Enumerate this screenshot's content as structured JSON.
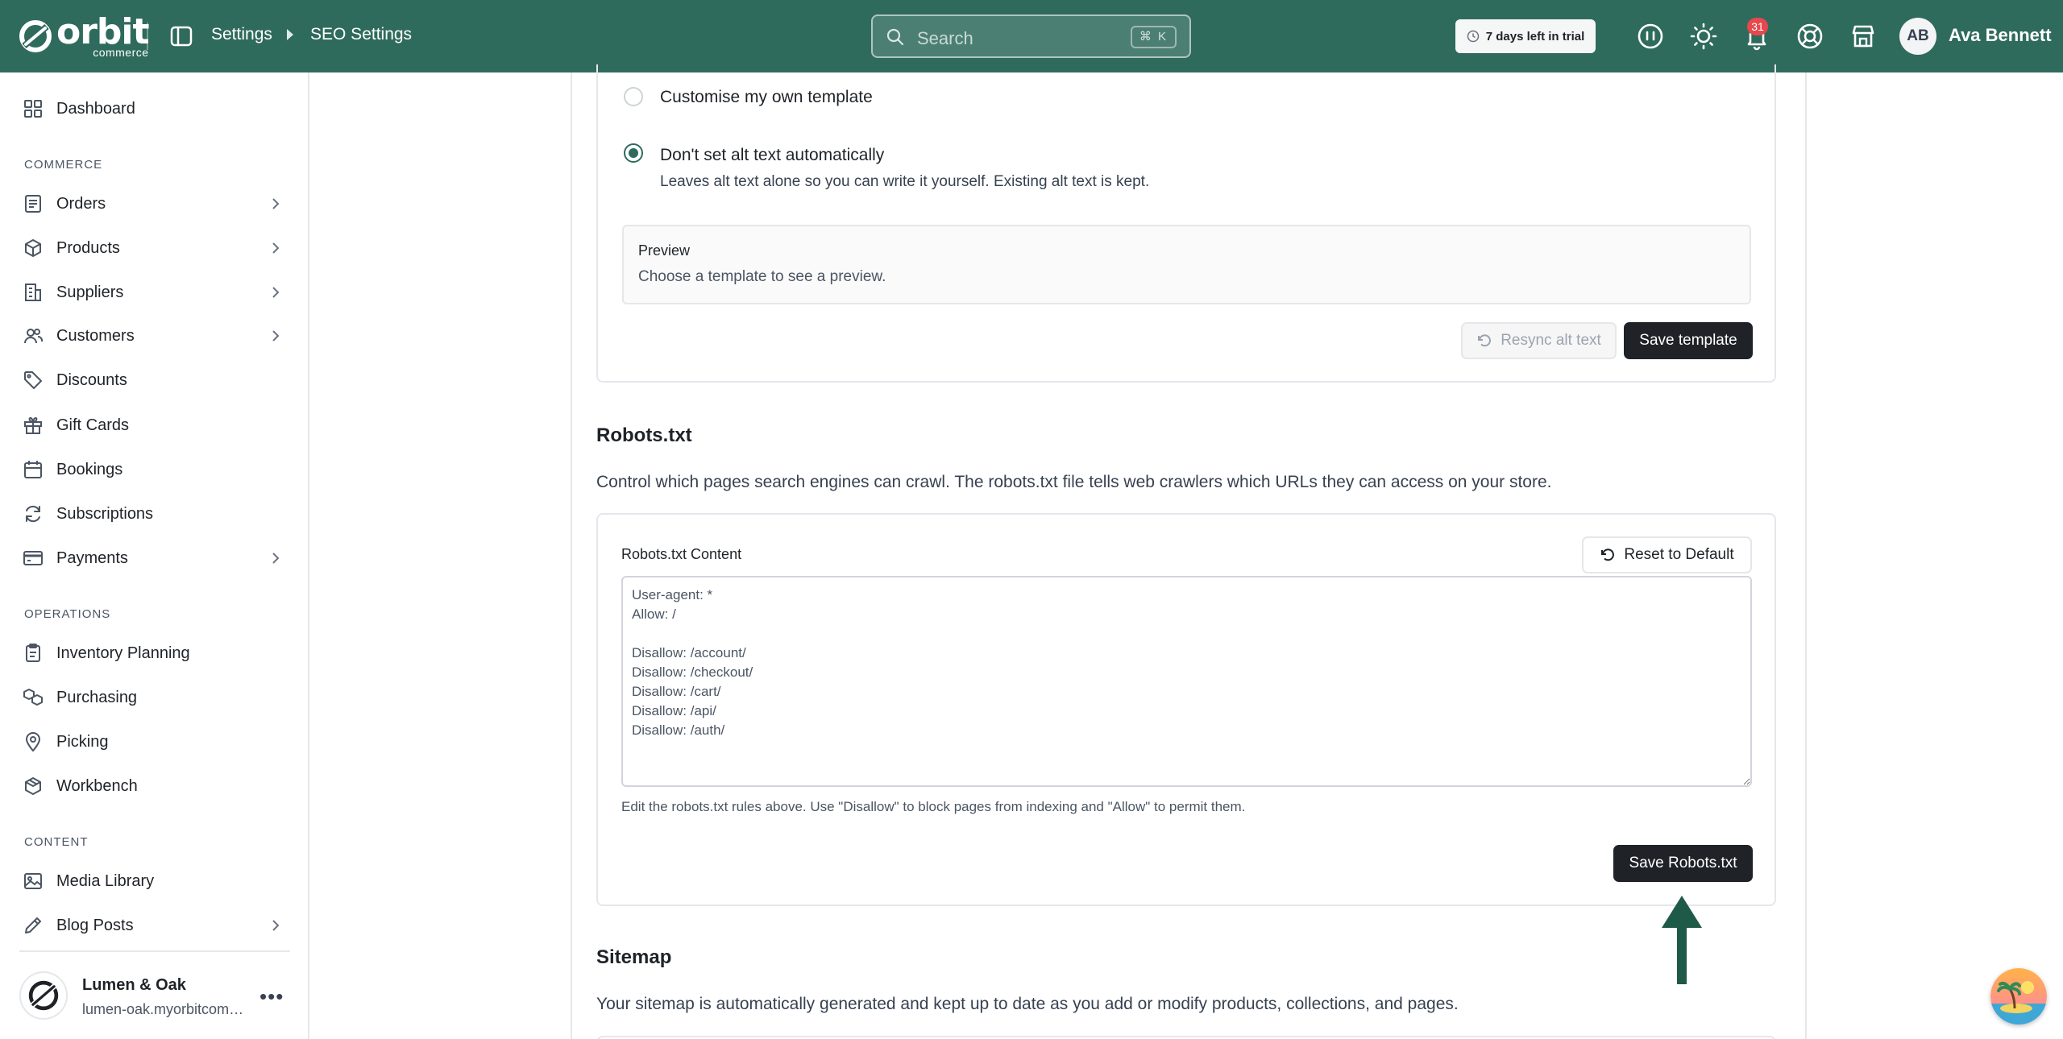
{
  "topbar": {
    "logo_word": "orbit",
    "logo_sub": "commerce",
    "breadcrumb": [
      "Settings",
      "SEO Settings"
    ],
    "search_placeholder": "Search",
    "search_shortcut": "⌘ K",
    "trial_text": "7 days left in trial",
    "notification_count": "31",
    "avatar_initials": "AB",
    "user_name": "Ava Bennett"
  },
  "sidebar": {
    "dashboard": "Dashboard",
    "sections": {
      "commerce": "COMMERCE",
      "operations": "OPERATIONS",
      "content": "CONTENT"
    },
    "commerce_items": [
      {
        "label": "Orders",
        "icon": "orders-icon",
        "has_children": true
      },
      {
        "label": "Products",
        "icon": "box-icon",
        "has_children": true
      },
      {
        "label": "Suppliers",
        "icon": "building-icon",
        "has_children": true
      },
      {
        "label": "Customers",
        "icon": "users-icon",
        "has_children": true
      },
      {
        "label": "Discounts",
        "icon": "tag-icon",
        "has_children": false
      },
      {
        "label": "Gift Cards",
        "icon": "gift-icon",
        "has_children": false
      },
      {
        "label": "Bookings",
        "icon": "calendar-icon",
        "has_children": false
      },
      {
        "label": "Subscriptions",
        "icon": "refresh-icon",
        "has_children": false
      },
      {
        "label": "Payments",
        "icon": "credit-card-icon",
        "has_children": true
      }
    ],
    "operations_items": [
      {
        "label": "Inventory Planning",
        "icon": "clipboard-icon"
      },
      {
        "label": "Purchasing",
        "icon": "boxes-icon"
      },
      {
        "label": "Picking",
        "icon": "map-pin-icon"
      },
      {
        "label": "Workbench",
        "icon": "package-icon"
      }
    ],
    "content_items": [
      {
        "label": "Media Library",
        "icon": "image-icon",
        "has_children": false
      },
      {
        "label": "Blog Posts",
        "icon": "pencil-icon",
        "has_children": true
      }
    ],
    "store": {
      "name": "Lumen & Oak",
      "url": "lumen-oak.myorbitcommerce.com"
    }
  },
  "alt_text": {
    "option_custom": "Customise my own template",
    "option_none": "Don't set alt text automatically",
    "option_none_desc": "Leaves alt text alone so you can write it yourself. Existing alt text is kept.",
    "selected": "none",
    "preview_title": "Preview",
    "preview_text": "Choose a template to see a preview.",
    "resync_label": "Resync alt text",
    "save_label": "Save template"
  },
  "robots": {
    "title": "Robots.txt",
    "description": "Control which pages search engines can crawl. The robots.txt file tells web crawlers which URLs they can access on your store.",
    "field_label": "Robots.txt Content",
    "reset_label": "Reset to Default",
    "content": "User-agent: *\nAllow: /\n\nDisallow: /account/\nDisallow: /checkout/\nDisallow: /cart/\nDisallow: /api/\nDisallow: /auth/",
    "help": "Edit the robots.txt rules above. Use \"Disallow\" to block pages from indexing and \"Allow\" to permit them.",
    "save_label": "Save Robots.txt"
  },
  "sitemap": {
    "title": "Sitemap",
    "description": "Your sitemap is automatically generated and kept up to date as you add or modify products, collections, and pages."
  },
  "colors": {
    "brand": "#2f6b5c",
    "dark_button": "#1f2328",
    "arrow": "#1f5a49",
    "badge": "#e5484d"
  }
}
